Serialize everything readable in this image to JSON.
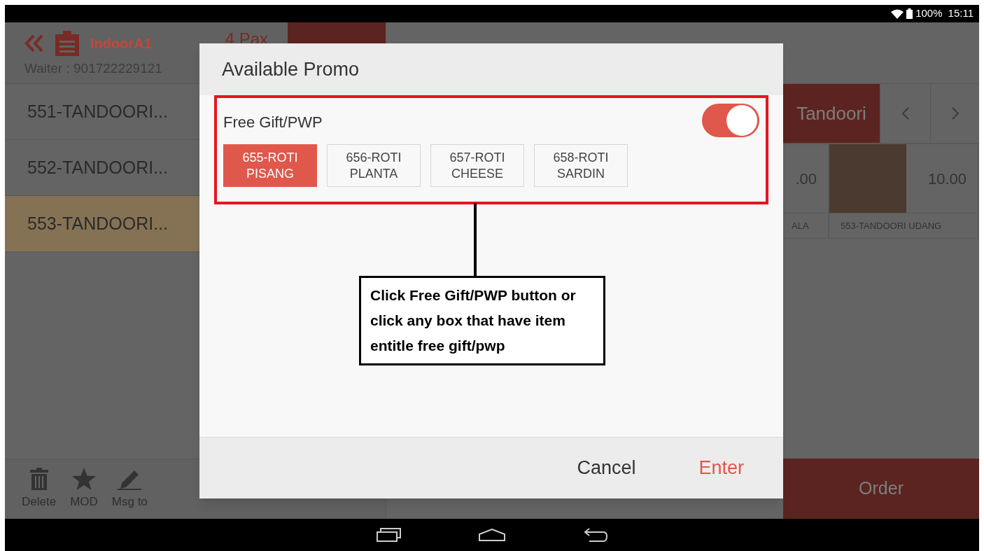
{
  "status_bar": {
    "battery": "100%",
    "time": "15:11"
  },
  "header": {
    "table": "IndoorA1",
    "waiter": "Waiter : 901722229121",
    "pax": "4 Pax"
  },
  "order_items": [
    {
      "name": "551-TANDOORI...",
      "selected": false
    },
    {
      "name": "552-TANDOORI...",
      "selected": false
    },
    {
      "name": "553-TANDOORI...",
      "selected": true
    }
  ],
  "toolbar": [
    {
      "label": "Delete",
      "kind": "delete"
    },
    {
      "label": "MOD",
      "kind": "star"
    },
    {
      "label": "Msg to",
      "kind": "pencil"
    }
  ],
  "categories": [
    {
      "label": "Tandoori",
      "selected": true
    }
  ],
  "products": [
    {
      "price": ".00",
      "name": "ALA",
      "photo": false
    },
    {
      "price": "10.00",
      "name": "553-TANDOORI UDANG",
      "photo": true
    }
  ],
  "order_button": "Order",
  "dialog": {
    "title": "Available Promo",
    "promo": {
      "label": "Free Gift/PWP",
      "on": true,
      "options": [
        {
          "label": "655-ROTI\nPISANG",
          "selected": true
        },
        {
          "label": "656-ROTI\nPLANTA",
          "selected": false
        },
        {
          "label": "657-ROTI\nCHEESE",
          "selected": false
        },
        {
          "label": "658-ROTI\nSARDIN",
          "selected": false
        }
      ]
    },
    "buttons": [
      {
        "label": "Cancel",
        "kind": "secondary"
      },
      {
        "label": "Enter",
        "kind": "primary"
      }
    ]
  },
  "annotation": {
    "text": "Click Free Gift/PWP button or click any box that have item entitle free gift/pwp"
  }
}
